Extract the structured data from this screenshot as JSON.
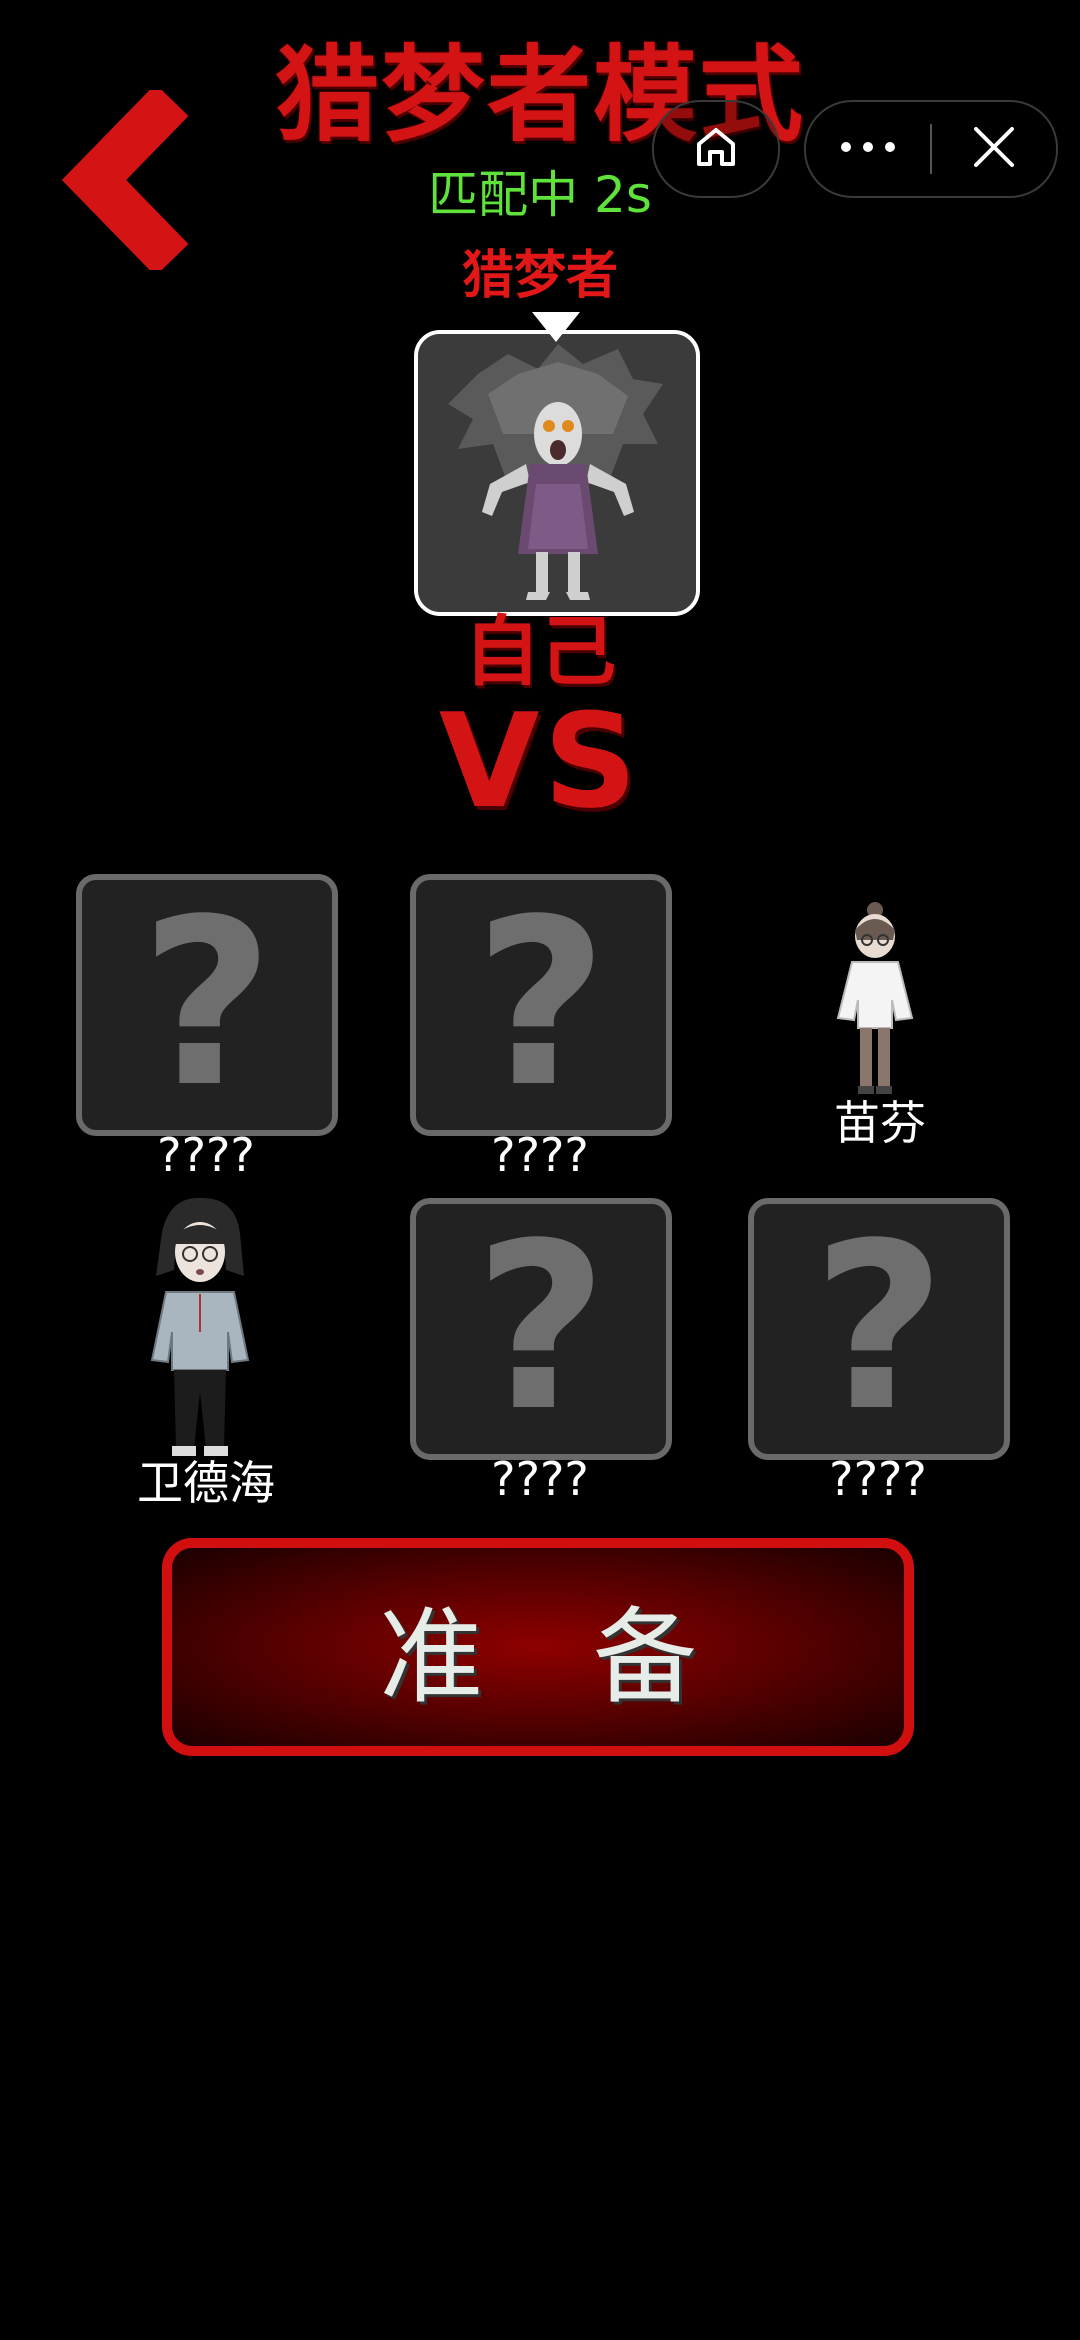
{
  "header": {
    "title": "猎梦者模式",
    "status": "匹配中  2s"
  },
  "hunter": {
    "role_label": "猎梦者",
    "self_label": "自己"
  },
  "versus": "VS",
  "players": [
    {
      "name": "????",
      "revealed": false
    },
    {
      "name": "????",
      "revealed": false
    },
    {
      "name": "苗芬",
      "revealed": true
    },
    {
      "name": "卫德海",
      "revealed": true
    },
    {
      "name": "????",
      "revealed": false
    },
    {
      "name": "????",
      "revealed": false
    }
  ],
  "ready_button": {
    "label": "准备"
  },
  "colors": {
    "accent_red": "#d41414",
    "status_green": "#5fe33a",
    "background": "#000000"
  },
  "icons": {
    "back": "chevron-left-icon",
    "home": "home-icon",
    "more": "more-dots-icon",
    "close": "close-icon",
    "pointer": "triangle-down-icon"
  }
}
